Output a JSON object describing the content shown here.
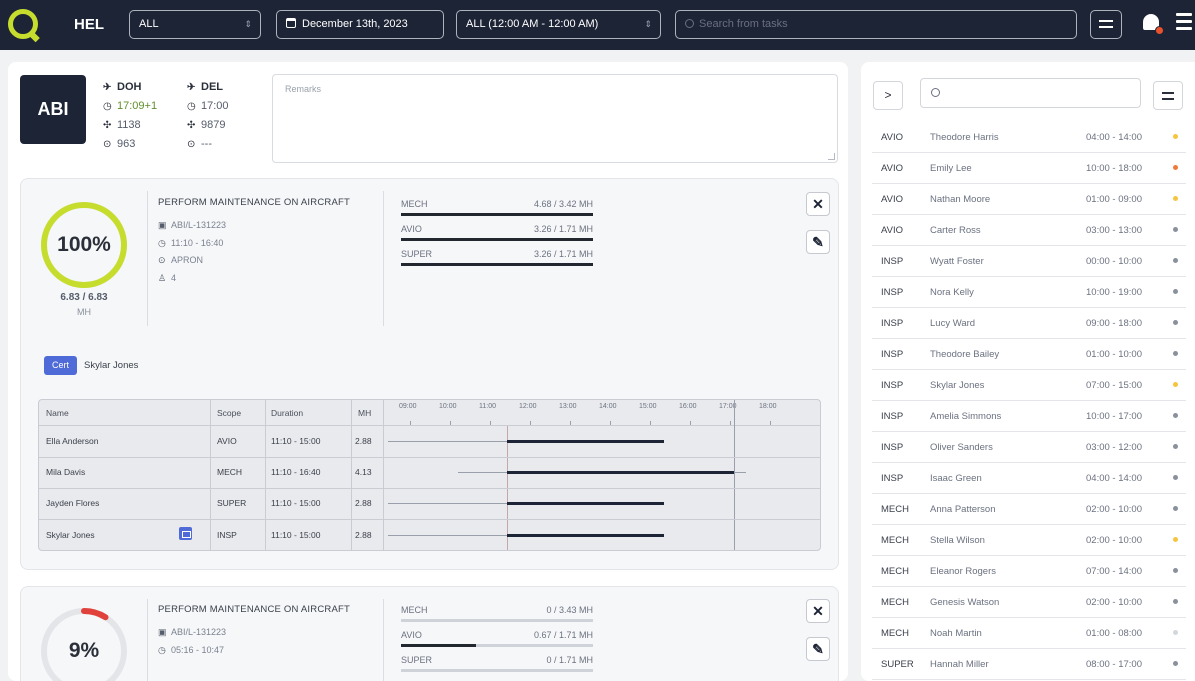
{
  "topbar": {
    "station": "HEL",
    "filter_value": "ALL",
    "date": "December 13th, 2023",
    "time_range": "ALL (12:00 AM - 12:00 AM)",
    "search_placeholder": "Search from tasks"
  },
  "aircraft": {
    "code": "ABI",
    "arrival": {
      "station": "DOH",
      "time": "17:09+1",
      "flight": "1138",
      "stand": "963"
    },
    "departure": {
      "station": "DEL",
      "time": "17:00",
      "flight": "9879",
      "stand": "---"
    },
    "remarks_placeholder": "Remarks"
  },
  "tasks": [
    {
      "percent": "100%",
      "progress": 1.0,
      "ring_color": "#c6dd2e",
      "mh_total": "6.83 / 6.83",
      "mh_unit": "MH",
      "title": "PERFORM MAINTENANCE ON AIRCRAFT",
      "ref": "ABI/L-131223",
      "time": "11:10 - 16:40",
      "location": "APRON",
      "people": "4",
      "trades": [
        {
          "label": "MECH",
          "value": "4.68 / 3.42 MH",
          "fill": 1.0
        },
        {
          "label": "AVIO",
          "value": "3.26 / 1.71 MH",
          "fill": 1.0
        },
        {
          "label": "SUPER",
          "value": "3.26 / 1.71 MH",
          "fill": 1.0
        }
      ],
      "cert_label": "Cert",
      "cert_name": "Skylar Jones",
      "schedule": {
        "headers": {
          "name": "Name",
          "scope": "Scope",
          "duration": "Duration",
          "mh": "MH"
        },
        "ticks": [
          "09:00",
          "10:00",
          "11:00",
          "12:00",
          "13:00",
          "14:00",
          "15:00",
          "16:00",
          "17:00",
          "18:00"
        ],
        "rows": [
          {
            "name": "Ella Anderson",
            "scope": "AVIO",
            "duration": "11:10 - 15:00",
            "mh": "2.88"
          },
          {
            "name": "Mila Davis",
            "scope": "MECH",
            "duration": "11:10 - 16:40",
            "mh": "4.13"
          },
          {
            "name": "Jayden Flores",
            "scope": "SUPER",
            "duration": "11:10 - 15:00",
            "mh": "2.88"
          },
          {
            "name": "Skylar Jones",
            "scope": "INSP",
            "duration": "11:10 - 15:00",
            "mh": "2.88"
          }
        ]
      }
    },
    {
      "percent": "9%",
      "progress": 0.09,
      "ring_color": "#e0413a",
      "title": "PERFORM MAINTENANCE ON AIRCRAFT",
      "ref": "ABI/L-131223",
      "time": "05:16 - 10:47",
      "trades": [
        {
          "label": "MECH",
          "value": "0 / 3.43 MH",
          "fill": 0.0
        },
        {
          "label": "AVIO",
          "value": "0.67 / 1.71 MH",
          "fill": 0.39
        },
        {
          "label": "SUPER",
          "value": "0 / 1.71 MH",
          "fill": 0.0
        }
      ]
    }
  ],
  "staff_panel": {
    "collapse_label": ">",
    "staff": [
      {
        "trade": "AVIO",
        "name": "Theodore Harris",
        "hours": "04:00 - 14:00",
        "dot": "#f5c542"
      },
      {
        "trade": "AVIO",
        "name": "Emily Lee",
        "hours": "10:00 - 18:00",
        "dot": "#ef7a3c"
      },
      {
        "trade": "AVIO",
        "name": "Nathan Moore",
        "hours": "01:00 - 09:00",
        "dot": "#f5c542"
      },
      {
        "trade": "AVIO",
        "name": "Carter Ross",
        "hours": "03:00 - 13:00",
        "dot": "#8a909c"
      },
      {
        "trade": "INSP",
        "name": "Wyatt Foster",
        "hours": "00:00 - 10:00",
        "dot": "#8a909c"
      },
      {
        "trade": "INSP",
        "name": "Nora Kelly",
        "hours": "10:00 - 19:00",
        "dot": "#8a909c"
      },
      {
        "trade": "INSP",
        "name": "Lucy Ward",
        "hours": "09:00 - 18:00",
        "dot": "#8a909c"
      },
      {
        "trade": "INSP",
        "name": "Theodore Bailey",
        "hours": "01:00 - 10:00",
        "dot": "#8a909c"
      },
      {
        "trade": "INSP",
        "name": "Skylar Jones",
        "hours": "07:00 - 15:00",
        "dot": "#f5c542"
      },
      {
        "trade": "INSP",
        "name": "Amelia Simmons",
        "hours": "10:00 - 17:00",
        "dot": "#8a909c"
      },
      {
        "trade": "INSP",
        "name": "Oliver Sanders",
        "hours": "03:00 - 12:00",
        "dot": "#8a909c"
      },
      {
        "trade": "INSP",
        "name": "Isaac Green",
        "hours": "04:00 - 14:00",
        "dot": "#8a909c"
      },
      {
        "trade": "MECH",
        "name": "Anna Patterson",
        "hours": "02:00 - 10:00",
        "dot": "#8a909c"
      },
      {
        "trade": "MECH",
        "name": "Stella Wilson",
        "hours": "02:00 - 10:00",
        "dot": "#f5c542"
      },
      {
        "trade": "MECH",
        "name": "Eleanor Rogers",
        "hours": "07:00 - 14:00",
        "dot": "#8a909c"
      },
      {
        "trade": "MECH",
        "name": "Genesis Watson",
        "hours": "02:00 - 10:00",
        "dot": "#8a909c"
      },
      {
        "trade": "MECH",
        "name": "Noah Martin",
        "hours": "01:00 - 08:00",
        "dot": "#d3d6db"
      },
      {
        "trade": "SUPER",
        "name": "Hannah Miller",
        "hours": "08:00 - 17:00",
        "dot": "#8a909c"
      }
    ]
  }
}
